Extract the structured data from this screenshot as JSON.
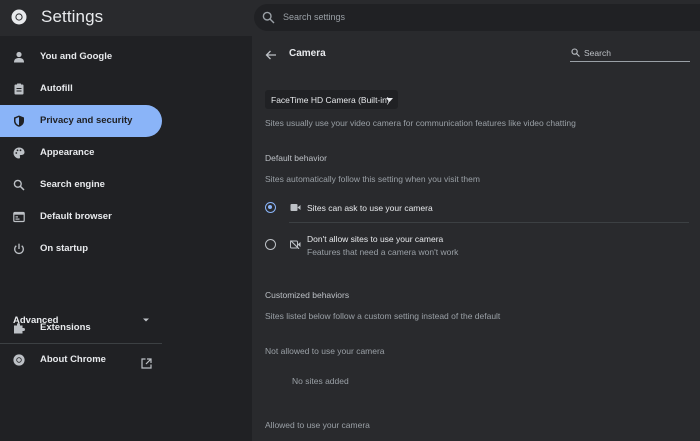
{
  "app": {
    "title": "Settings",
    "search_placeholder": "Search settings"
  },
  "sidebar": {
    "items": [
      {
        "label": "You and Google",
        "icon": "person-icon"
      },
      {
        "label": "Autofill",
        "icon": "clipboard-icon"
      },
      {
        "label": "Privacy and security",
        "icon": "shield-icon",
        "active": true
      },
      {
        "label": "Appearance",
        "icon": "palette-icon"
      },
      {
        "label": "Search engine",
        "icon": "search-icon"
      },
      {
        "label": "Default browser",
        "icon": "browser-icon"
      },
      {
        "label": "On startup",
        "icon": "power-icon"
      }
    ],
    "advanced_label": "Advanced",
    "extensions_label": "Extensions",
    "about_label": "About Chrome"
  },
  "camera_page": {
    "title": "Camera",
    "search_placeholder": "Search",
    "selected_camera": "FaceTime HD Camera (Built-in)",
    "camera_description": "Sites usually use your video camera for communication features like video chatting",
    "default_behavior_heading": "Default behavior",
    "default_behavior_description": "Sites automatically follow this setting when you visit them",
    "option_allow_label": "Sites can ask to use your camera",
    "option_block_label": "Don't allow sites to use your camera",
    "option_block_sublabel": "Features that need a camera won't work",
    "customized_heading": "Customized behaviors",
    "customized_description": "Sites listed below follow a custom setting instead of the default",
    "not_allowed_heading": "Not allowed to use your camera",
    "no_sites_text": "No sites added",
    "allowed_heading": "Allowed to use your camera"
  },
  "colors": {
    "accent": "#8ab4f8",
    "background": "#202124",
    "panel": "#292a2d"
  }
}
